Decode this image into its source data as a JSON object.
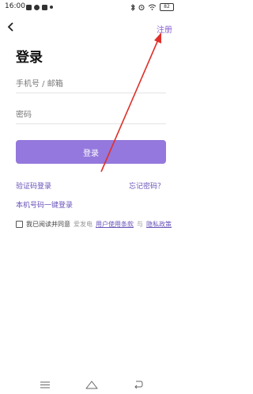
{
  "status_bar": {
    "time": "16:00",
    "battery": "82"
  },
  "header": {
    "register_label": "注册"
  },
  "page_title": "登录",
  "form": {
    "phone_placeholder": "手机号 / 邮箱",
    "password_placeholder": "密码",
    "login_label": "登录"
  },
  "links": {
    "code_login": "验证码登录",
    "forgot_password": "忘记密码？",
    "one_key_login": "本机号码一键登录"
  },
  "agreement": {
    "prefix": "我已阅读并同意",
    "brand": "爱发电",
    "terms": "用户使用条款",
    "and": "与",
    "privacy": "隐私政策"
  },
  "colors": {
    "accent": "#9478dd",
    "link": "#6a53b8",
    "annotation": "#e0302a"
  }
}
